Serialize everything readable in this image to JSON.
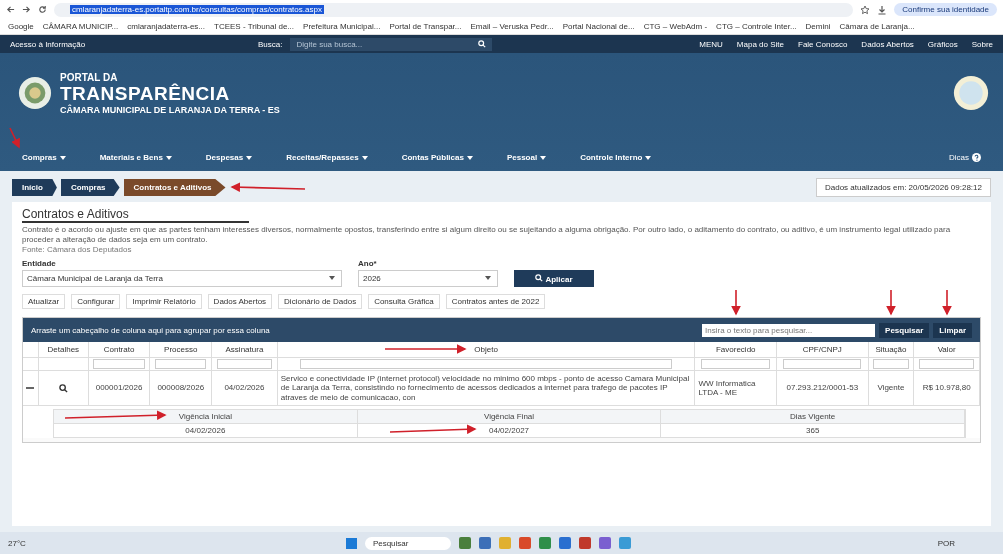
{
  "browser": {
    "url": "cmlaranjadaterra-es.portaltp.com.br/consultas/compras/contratos.aspx",
    "profile": "Confirme sua identidade",
    "bookmarks": [
      "Google",
      "CÂMARA MUNICIP...",
      "cmlaranjadaterra-es...",
      "TCEES - Tribunal de...",
      "Prefeitura Municipal...",
      "Portal de Transpar...",
      "Email – Veruska Pedr...",
      "Portal Nacional de...",
      "CTG – WebAdm -",
      "CTG – Controle Inter...",
      "Demini",
      "Câmara de Laranja..."
    ]
  },
  "topbar": {
    "access": "Acesso à Informação",
    "search_label": "Busca:",
    "search_placeholder": "Digite sua busca...",
    "links": [
      "MENU",
      "Mapa do Site",
      "Fale Conosco",
      "Dados Abertos",
      "Gráficos",
      "Sobre"
    ]
  },
  "header": {
    "line1": "PORTAL DA",
    "line2": "TRANSPARÊNCIA",
    "line3": "CÂMARA MUNICIPAL DE LARANJA DA TERRA - ES",
    "tips": "Dicas"
  },
  "menu": [
    "Compras",
    "Materiais e Bens",
    "Despesas",
    "Receitas/Repasses",
    "Contas Públicas",
    "Pessoal",
    "Controle Interno"
  ],
  "breadcrumb": [
    {
      "label": "Início",
      "selected": false
    },
    {
      "label": "Compras",
      "selected": false
    },
    {
      "label": "Contratos e Aditivos",
      "selected": true
    }
  ],
  "updated": "Dados atualizados em: 20/05/2026 09:28:12",
  "page": {
    "title": "Contratos e Aditivos",
    "description": "Contrato é o acordo ou ajuste em que as partes tenham interesses diversos, normalmente opostos, transferindo entre si algum direito ou se sujeitando a alguma obrigação. Por outro lado, o aditamento do contrato, ou aditivo, é um instrumento legal utilizado para proceder a alteração de dados seja em um contrato.",
    "source": "Fonte: Câmara dos Deputados"
  },
  "filters": {
    "entity_label": "Entidade",
    "entity_value": "Câmara Municipal de Laranja da Terra",
    "year_label": "Ano*",
    "year_value": "2026",
    "apply": "Aplicar"
  },
  "toolbar": [
    "Atualizar",
    "Configurar",
    "Imprimir Relatório",
    "Dados Abertos",
    "Dicionário de Dados",
    "Consulta Gráfica",
    "Contratos antes de 2022"
  ],
  "grid": {
    "group_hint": "Arraste um cabeçalho de coluna aqui para agrupar por essa coluna",
    "search_placeholder": "Insira o texto para pesquisar...",
    "search_button": "Pesquisar",
    "clear_button": "Limpar",
    "columns": [
      "Detalhes",
      "Contrato",
      "Processo",
      "Assinatura",
      "Objeto",
      "Favorecido",
      "CPF/CNPJ",
      "Situação",
      "Valor"
    ],
    "row": {
      "contract": "000001/2026",
      "process": "000008/2026",
      "signed": "04/02/2026",
      "object": "Servico e conectividade IP (internet protocol) velocidade no minimo 600 mbps - ponto de acesso Camara Municipal de Laranja da Terra, consistindo no fornecimento de acessos dedicados a internet para trafego de pacotes IP atraves de meio de comunicacao, con",
      "supplier": "WW Informatica LTDA - ME",
      "cnpj": "07.293.212/0001-53",
      "status": "Vigente",
      "value": "R$ 10.978,80",
      "expanded": true
    },
    "detail": {
      "labels": [
        "Vigência Inicial",
        "Vigência Final",
        "Dias Vigente"
      ],
      "values": [
        "04/02/2026",
        "04/02/2027",
        "365"
      ]
    }
  },
  "taskbar": {
    "weather": "27°C",
    "search": "Pesquisar",
    "lang": "POR"
  }
}
